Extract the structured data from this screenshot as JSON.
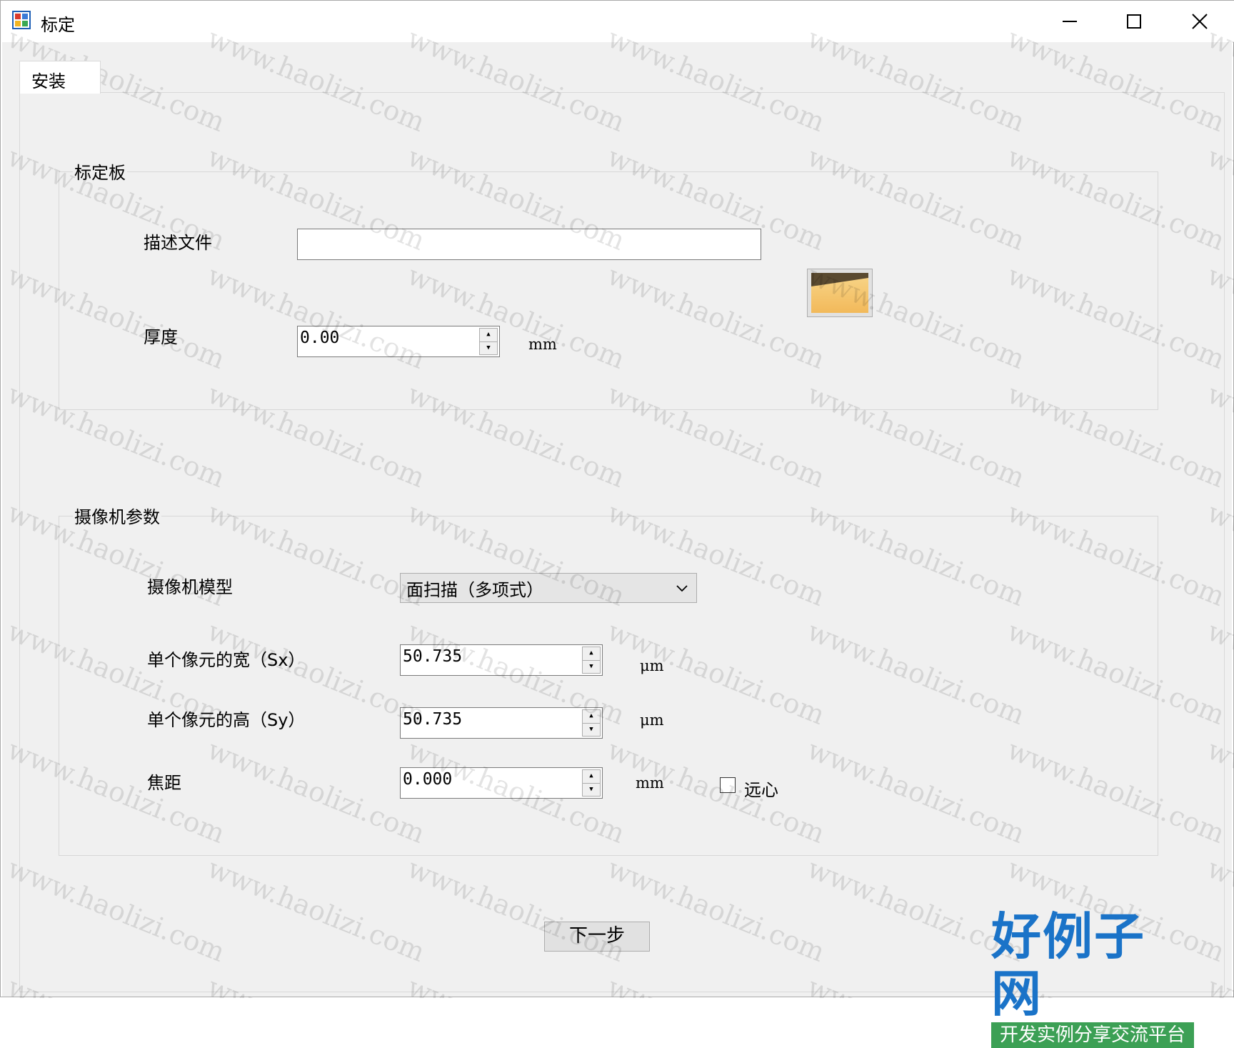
{
  "window": {
    "title": "标定",
    "app_icon": "app-icon",
    "controls": [
      "minimize-icon",
      "maximize-icon",
      "close-icon"
    ]
  },
  "tabs": [
    {
      "label": "安装",
      "selected": true
    }
  ],
  "calibration_board": {
    "title": "标定板",
    "description_file_label": "描述文件",
    "description_file_value": "",
    "browse_icon": "folder-icon",
    "thickness_label": "厚度",
    "thickness_value": "0.00",
    "thickness_unit": "mm"
  },
  "camera_params": {
    "title": "摄像机参数",
    "model_label": "摄像机模型",
    "model_value": "面扫描（多项式）",
    "sx_label": "单个像元的宽（Sx）",
    "sx_value": "50.735",
    "sx_unit": "μm",
    "sy_label": "单个像元的高（Sy）",
    "sy_value": "50.735",
    "sy_unit": "μm",
    "focal_label": "焦距",
    "focal_value": "0.000",
    "focal_unit": "mm",
    "telecentric_label": "远心",
    "telecentric_checked": false
  },
  "next_button": "下一步",
  "watermark_text": "www.haolizi.com",
  "brand": {
    "title": "好例子网",
    "subtitle": "开发实例分享交流平台"
  }
}
